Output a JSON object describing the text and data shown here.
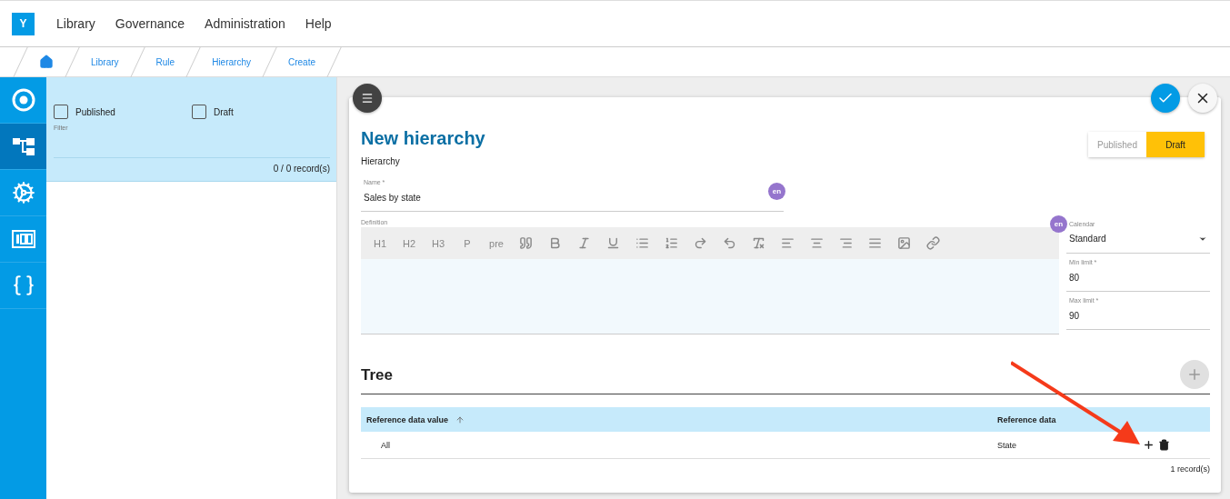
{
  "app": {
    "logo": "Y"
  },
  "menu": [
    {
      "label": "Library"
    },
    {
      "label": "Governance"
    },
    {
      "label": "Administration"
    },
    {
      "label": "Help"
    }
  ],
  "breadcrumb": [
    "Library",
    "Rule",
    "Hierarchy",
    "Create"
  ],
  "sidebar": {
    "items": [
      {
        "selected": false
      },
      {
        "selected": true
      },
      {
        "selected": false
      },
      {
        "selected": false
      },
      {
        "selected": false
      }
    ]
  },
  "filter": {
    "checkboxes": [
      {
        "label": "Published",
        "checked": false
      },
      {
        "label": "Draft",
        "checked": false
      }
    ],
    "caption": "Filter",
    "count": "0 / 0 record(s)"
  },
  "form": {
    "title": "New hierarchy",
    "subtitle": "Hierarchy",
    "status": [
      {
        "label": "Published",
        "selected": false
      },
      {
        "label": "Draft",
        "selected": true
      }
    ],
    "name": {
      "label": "Name *",
      "value": "Sales by state",
      "language": "en"
    },
    "definition": {
      "label": "Definition",
      "language": "en",
      "toolbar_text": [
        "H1",
        "H2",
        "H3",
        "P",
        "pre"
      ]
    },
    "calendar": {
      "label": "Calendar",
      "value": "Standard"
    },
    "min_limit": {
      "label": "Min limit *",
      "value": "80"
    },
    "max_limit": {
      "label": "Max limit *",
      "value": "90"
    }
  },
  "tree": {
    "title": "Tree",
    "columns": [
      {
        "label": "Reference data value",
        "sorted": true
      },
      {
        "label": "Reference data",
        "sorted": false
      }
    ],
    "rows": [
      {
        "cells": [
          "All",
          "State"
        ]
      }
    ],
    "count": "1 record(s)"
  }
}
